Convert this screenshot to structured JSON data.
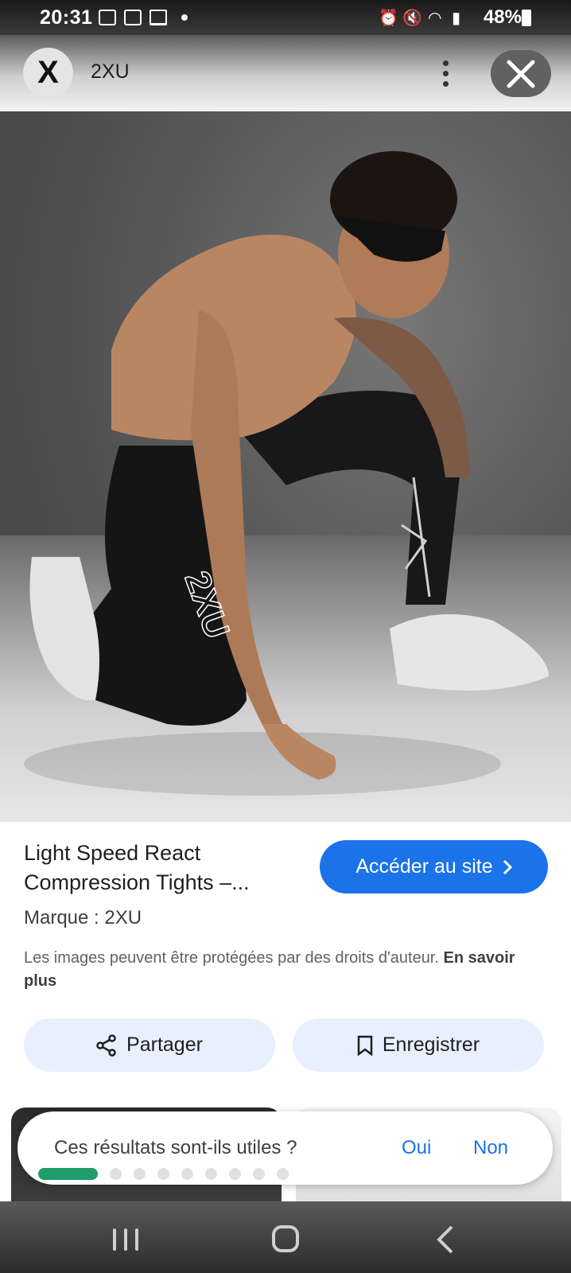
{
  "status_bar": {
    "time": "20:31",
    "battery": "48%"
  },
  "header": {
    "logo_text": "X",
    "title": "2XU"
  },
  "product": {
    "title_line1": "Light Speed React",
    "title_line2": "Compression Tights –...",
    "brand": "Marque : 2XU",
    "copyright_text": "Les images peuvent être protégées par des droits d'auteur.",
    "learn_more": "En savoir plus",
    "image_brand_text": "2XU"
  },
  "buttons": {
    "visit": "Accéder au site",
    "share": "Partager",
    "save": "Enregistrer"
  },
  "feedback": {
    "question": "Ces résultats sont-ils utiles ?",
    "yes": "Oui",
    "no": "Non",
    "steps_total": 9,
    "step_current": 1
  },
  "colors": {
    "accent": "#1a73e8",
    "chip_bg": "#e8f0fe",
    "progress": "#1e9e6a"
  }
}
